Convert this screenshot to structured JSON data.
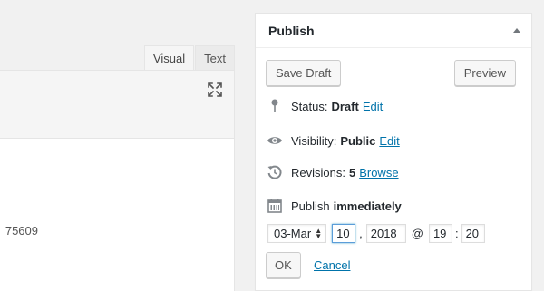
{
  "editor": {
    "tabs": [
      {
        "label": "Visual",
        "active": true
      },
      {
        "label": "Text",
        "active": false
      }
    ],
    "fullscreen_icon": "fullscreen-icon",
    "content_text": "75609"
  },
  "publish": {
    "title": "Publish",
    "save_draft_label": "Save Draft",
    "preview_label": "Preview",
    "status": {
      "label": "Status:",
      "value": "Draft",
      "edit": "Edit"
    },
    "visibility": {
      "label": "Visibility:",
      "value": "Public",
      "edit": "Edit"
    },
    "revisions": {
      "label": "Revisions:",
      "value": "5",
      "browse": "Browse"
    },
    "schedule": {
      "label": "Publish",
      "value": "immediately"
    },
    "date": {
      "month": "03-Mar",
      "day": "10",
      "comma": ",",
      "year": "2018",
      "at": "@",
      "hour": "19",
      "colon": ":",
      "minute": "20"
    },
    "ok_label": "OK",
    "cancel_label": "Cancel"
  },
  "colors": {
    "link": "#0073aa",
    "background": "#f1f1f1",
    "focus": "#5b9dd9"
  }
}
